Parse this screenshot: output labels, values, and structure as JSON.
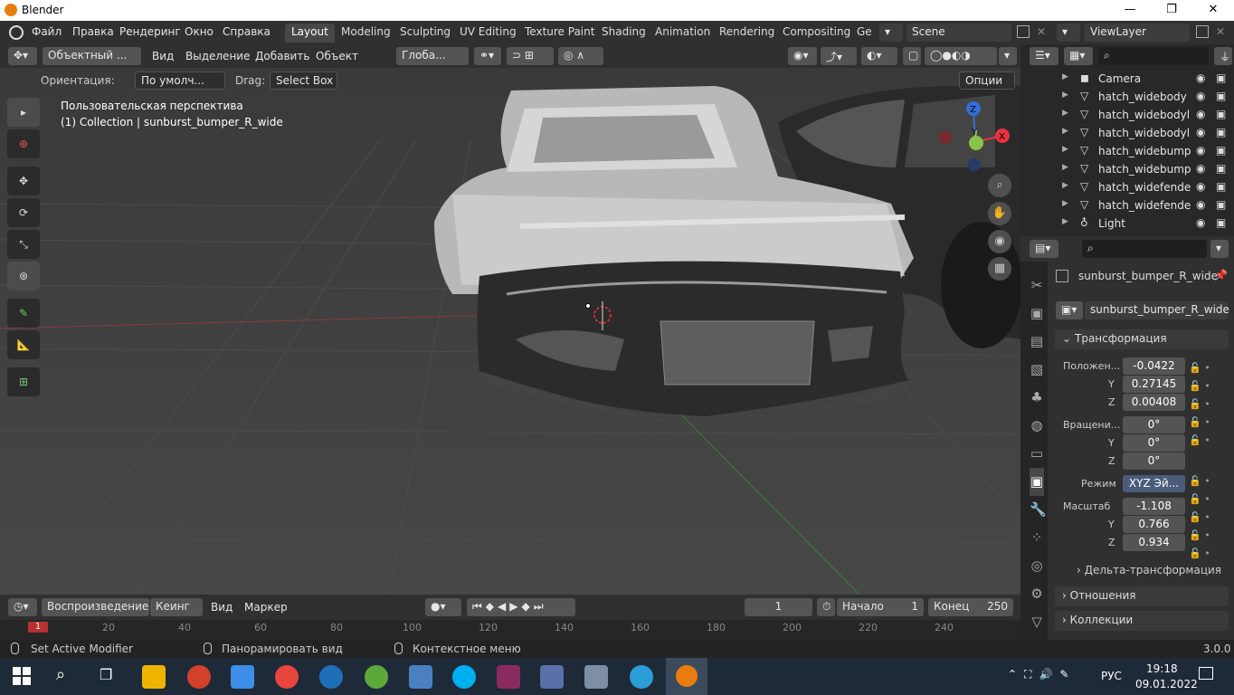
{
  "window": {
    "title": "Blender",
    "min": "—",
    "max": "❐",
    "close": "✕"
  },
  "menu": [
    "Файл",
    "Правка",
    "Рендеринг",
    "Окно",
    "Справка"
  ],
  "workspaces": [
    "Layout",
    "Modeling",
    "Sculpting",
    "UV Editing",
    "Texture Paint",
    "Shading",
    "Animation",
    "Rendering",
    "Compositing",
    "Ge"
  ],
  "scene": "Scene",
  "viewlayer": "ViewLayer",
  "vp_header": {
    "mode": "Объектный ...",
    "view": "Вид",
    "select": "Выделение",
    "add": "Добавить",
    "object": "Объект",
    "transform": "Глоба..."
  },
  "vp_bar2": {
    "orient_label": "Ориентация:",
    "orient_value": "По умолч...",
    "drag_label": "Drag:",
    "drag_value": "Select Box",
    "options": "Опции"
  },
  "viewport": {
    "line1": "Пользовательская перспектива",
    "line2": "(1) Collection | sunburst_bumper_R_wide"
  },
  "gizmo": {
    "z": "Z",
    "y": "Y",
    "x": "X"
  },
  "outliner": {
    "items": [
      {
        "name": "Camera",
        "icon": "camera-icon"
      },
      {
        "name": "hatch_widebody",
        "icon": "mesh-icon"
      },
      {
        "name": "hatch_widebodyl",
        "icon": "mesh-icon"
      },
      {
        "name": "hatch_widebodyl",
        "icon": "mesh-icon"
      },
      {
        "name": "hatch_widebump",
        "icon": "mesh-icon"
      },
      {
        "name": "hatch_widebump",
        "icon": "mesh-icon"
      },
      {
        "name": "hatch_widefende",
        "icon": "mesh-icon"
      },
      {
        "name": "hatch_widefende",
        "icon": "mesh-icon"
      },
      {
        "name": "Light",
        "icon": "light-icon"
      }
    ]
  },
  "props": {
    "object_name": "sunburst_bumper_R_wide",
    "data_name": "sunburst_bumper_R_wide",
    "transform_header": "Трансформация",
    "location_label": "Положен...",
    "loc": [
      "-0.0422",
      "0.27145",
      "0.00408"
    ],
    "rotation_label": "Вращени...",
    "rot": [
      "0°",
      "0°",
      "0°"
    ],
    "mode_label": "Режим",
    "mode_value": "XYZ Эй...",
    "scale_label": "Масштаб",
    "scale": [
      "-1.108",
      "0.766",
      "0.934"
    ],
    "y": "Y",
    "z": "Z",
    "delta": "Дельта-трансформация",
    "relations": "Отношения",
    "collections": "Коллекции"
  },
  "timeline": {
    "playback": "Воспроизведение",
    "keying": "Кеинг",
    "view": "Вид",
    "marker": "Маркер",
    "frame": "1",
    "start_label": "Начало",
    "start": "1",
    "end_label": "Конец",
    "end": "250",
    "ruler": [
      "1",
      "20",
      "40",
      "60",
      "80",
      "100",
      "120",
      "140",
      "160",
      "180",
      "200",
      "220",
      "240"
    ]
  },
  "status": {
    "left": "Set Active Modifier",
    "mid": "Панорамировать вид",
    "right": "Контекстное меню",
    "version": "3.0.0"
  },
  "taskbar": {
    "lang": "РУС",
    "time": "19:18",
    "date": "09.01.2022"
  },
  "colors": {
    "accent": "#4772b3",
    "bg": "#303030",
    "viewport": "#3d3d3d",
    "x_axis": "#e8333f",
    "y_axis": "#8bc34a",
    "z_axis": "#2f6fd6"
  }
}
